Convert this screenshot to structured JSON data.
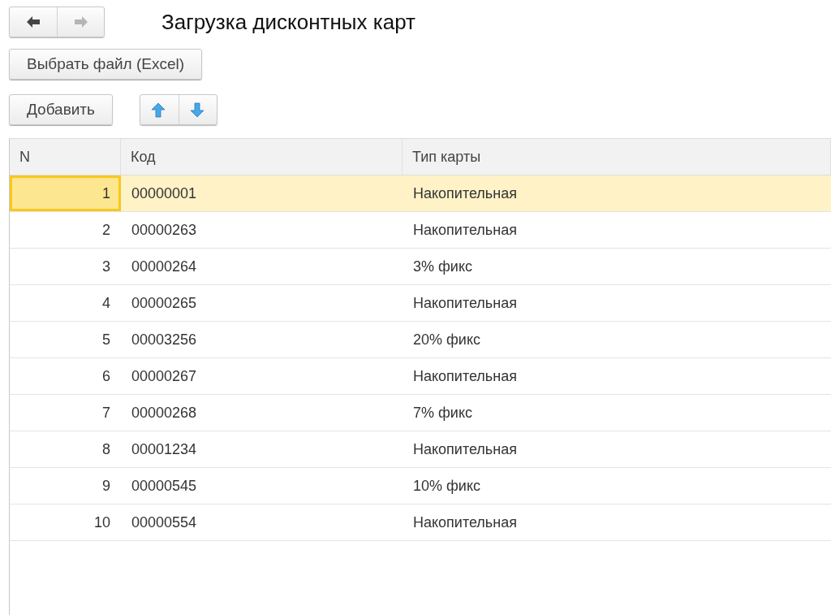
{
  "navigation": {
    "back": {
      "disabled": false
    },
    "forward": {
      "disabled": true
    }
  },
  "title": "Загрузка дисконтных карт",
  "buttons": {
    "choose_file": "Выбрать файл (Excel)",
    "add": "Добавить"
  },
  "table": {
    "columns": [
      "N",
      "Код",
      "Тип карты"
    ],
    "rows": [
      {
        "cells": [
          "1",
          "00000001",
          "Накопительная"
        ],
        "selected": true
      },
      {
        "cells": [
          "2",
          "00000263",
          "Накопительная"
        ],
        "selected": false
      },
      {
        "cells": [
          "3",
          "00000264",
          "3% фикс"
        ],
        "selected": false
      },
      {
        "cells": [
          "4",
          "00000265",
          "Накопительная"
        ],
        "selected": false
      },
      {
        "cells": [
          "5",
          "00003256",
          "20% фикс"
        ],
        "selected": false
      },
      {
        "cells": [
          "6",
          "00000267",
          "Накопительная"
        ],
        "selected": false
      },
      {
        "cells": [
          "7",
          "00000268",
          "7% фикс"
        ],
        "selected": false
      },
      {
        "cells": [
          "8",
          "00001234",
          "Накопительная"
        ],
        "selected": false
      },
      {
        "cells": [
          "9",
          "00000545",
          "10% фикс"
        ],
        "selected": false
      },
      {
        "cells": [
          "10",
          "00000554",
          "Накопительная"
        ],
        "selected": false
      }
    ]
  }
}
